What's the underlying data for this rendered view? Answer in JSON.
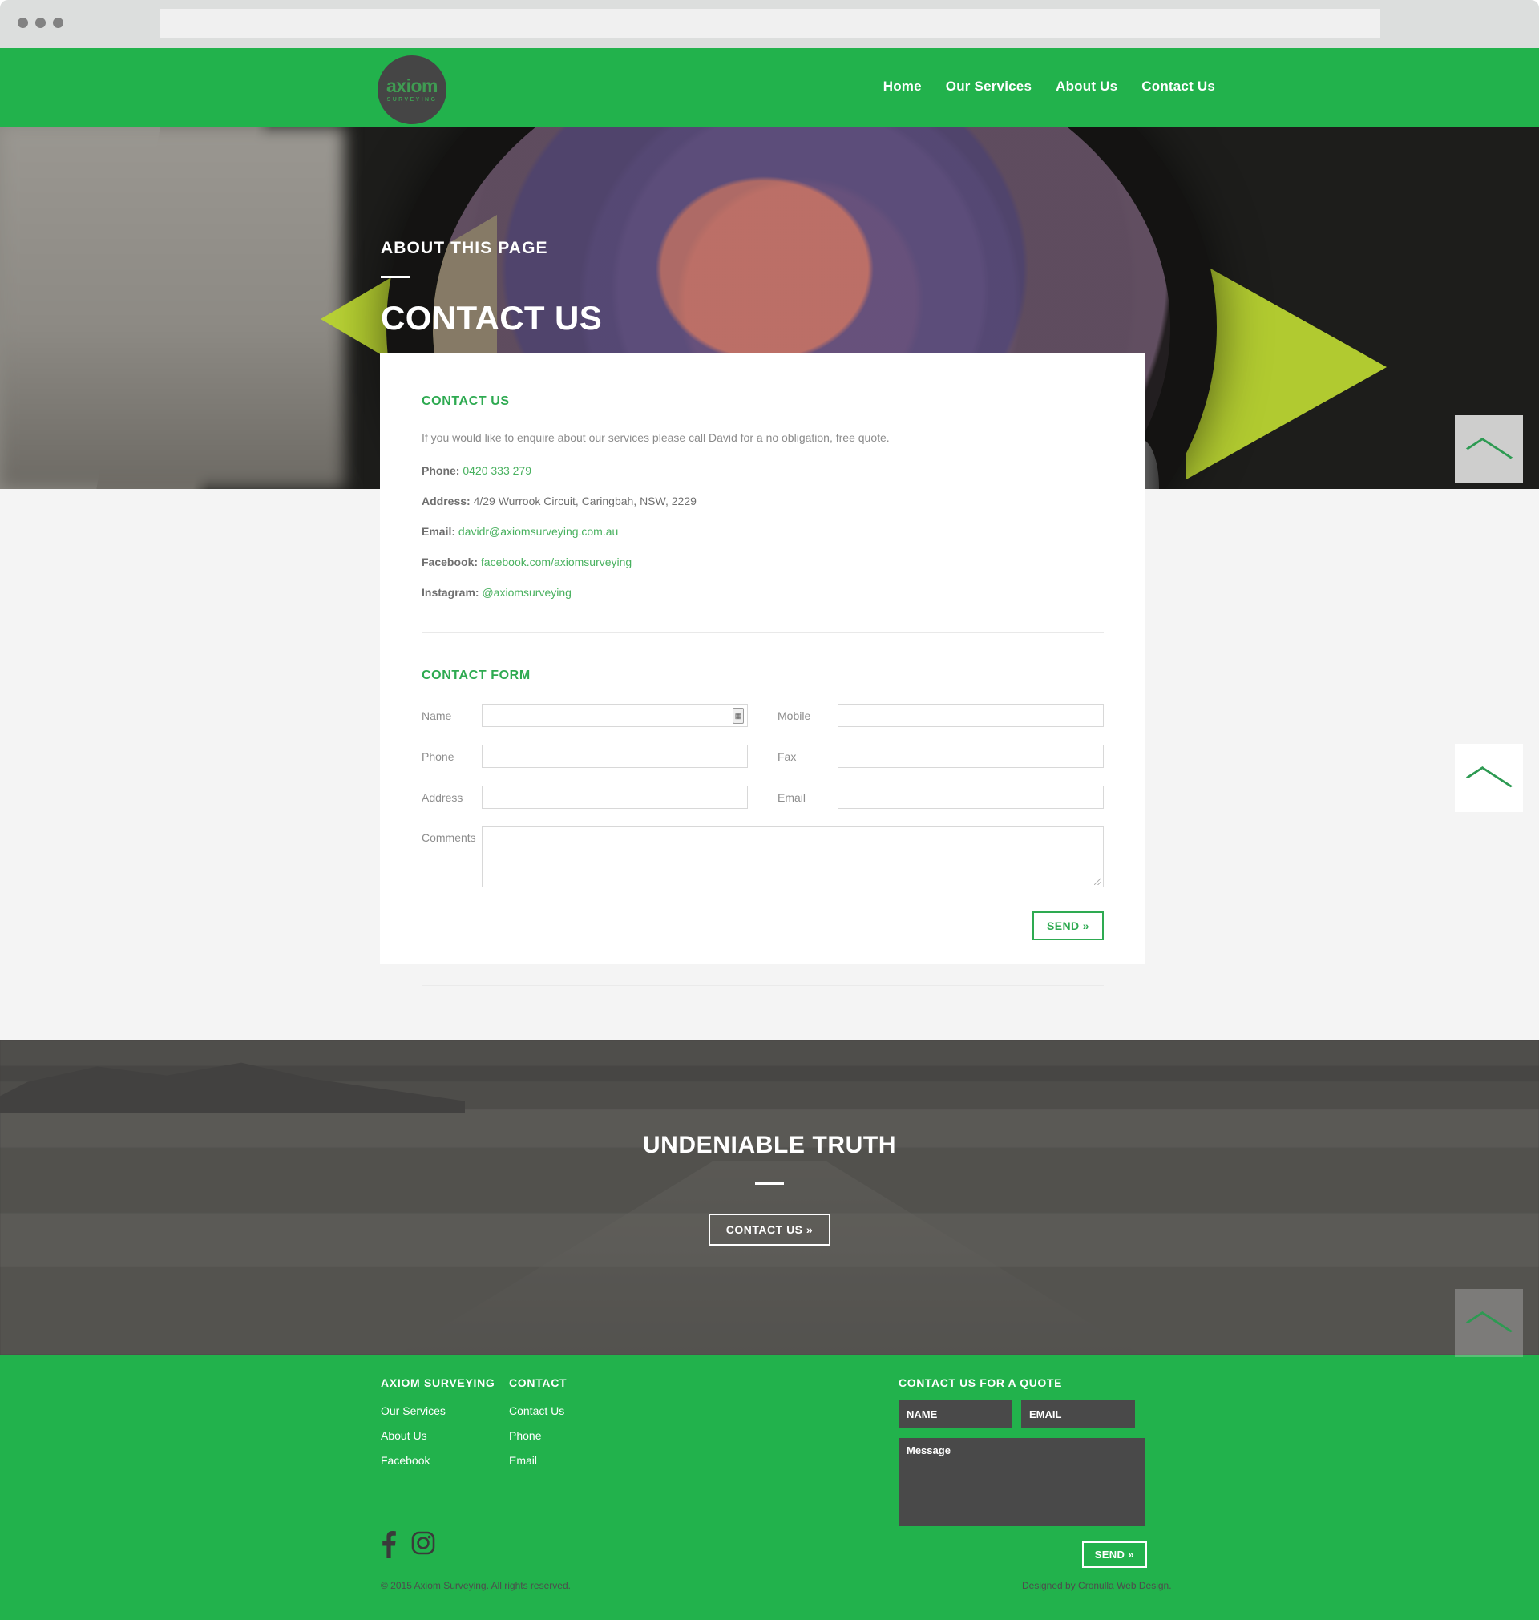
{
  "browser": {
    "dots": [
      "dot-1",
      "dot-2",
      "dot-3"
    ],
    "url": ""
  },
  "nav": {
    "logo": {
      "word": "axiom",
      "sub": "SURVEYING"
    },
    "links": [
      {
        "label": "Home"
      },
      {
        "label": "Our Services"
      },
      {
        "label": "About Us"
      },
      {
        "label": "Contact Us"
      }
    ]
  },
  "hero": {
    "kicker": "ABOUT THIS PAGE",
    "title": "CONTACT US"
  },
  "contact": {
    "heading": "CONTACT US",
    "lead": "If you would like to enquire about our services please call David for a no obligation, free quote.",
    "rows": [
      {
        "label": "Phone:",
        "value": "0420 333 279",
        "link": true
      },
      {
        "label": "Address:",
        "value": "4/29 Wurrook Circuit, Caringbah, NSW, 2229",
        "link": false
      },
      {
        "label": "Email:",
        "value": "davidr@axiomsurveying.com.au",
        "link": true
      },
      {
        "label": "Facebook:",
        "value": "facebook.com/axiomsurveying",
        "link": true
      },
      {
        "label": "Instagram:",
        "value": "@axiomsurveying",
        "link": true
      }
    ]
  },
  "form": {
    "heading": "CONTACT FORM",
    "fields": {
      "name": {
        "label": "Name",
        "value": "",
        "placeholder": ""
      },
      "mobile": {
        "label": "Mobile",
        "value": "",
        "placeholder": ""
      },
      "phone": {
        "label": "Phone",
        "value": "",
        "placeholder": ""
      },
      "fax": {
        "label": "Fax",
        "value": "",
        "placeholder": ""
      },
      "address": {
        "label": "Address",
        "value": "",
        "placeholder": ""
      },
      "email": {
        "label": "Email",
        "value": "",
        "placeholder": ""
      },
      "comments": {
        "label": "Comments",
        "value": "",
        "placeholder": ""
      }
    },
    "send_label": "SEND »"
  },
  "truth": {
    "title": "UNDENIABLE TRUTH",
    "button_label": "CONTACT US »"
  },
  "footer": {
    "col_one": {
      "heading": "AXIOM SURVEYING",
      "links": [
        {
          "label": "Our Services"
        },
        {
          "label": "About Us"
        },
        {
          "label": "Facebook"
        }
      ]
    },
    "col_two": {
      "heading": "CONTACT",
      "links": [
        {
          "label": "Contact Us"
        },
        {
          "label": "Phone"
        },
        {
          "label": "Email"
        }
      ]
    },
    "quote": {
      "heading": "CONTACT US FOR A QUOTE",
      "name_placeholder": "NAME",
      "email_placeholder": "EMAIL",
      "message_placeholder": "Message",
      "send_label": "SEND »"
    },
    "social": [
      {
        "name": "facebook"
      },
      {
        "name": "instagram"
      }
    ],
    "copyright": "© 2015 Axiom Surveying. All rights reserved.",
    "credit": "Designed by Cronulla Web Design."
  },
  "colors": {
    "brand_green": "#22b24c",
    "accent_green": "#2eaa51",
    "link_green": "#49b15f",
    "dark_gray": "#494949",
    "logo_gray": "#454545"
  }
}
